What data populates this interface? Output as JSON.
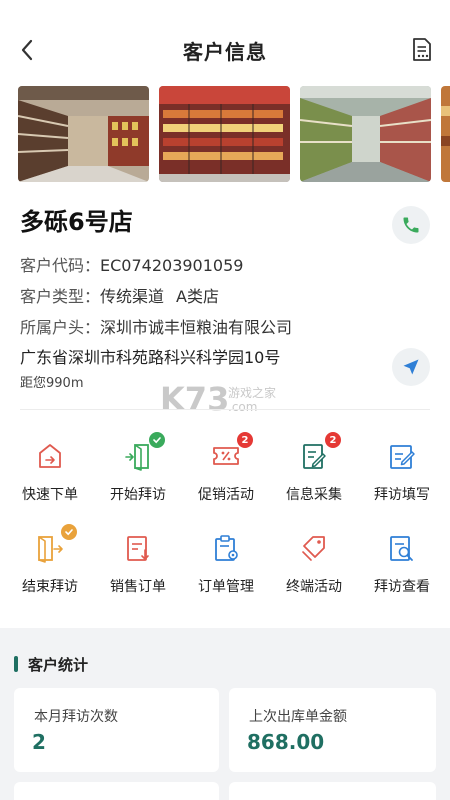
{
  "header": {
    "title": "客户信息",
    "back_icon": "chevron-left-icon",
    "action_icon": "document-list-icon"
  },
  "store": {
    "name": "多砾6号店",
    "code_label": "客户代码：",
    "code_value": "EC074203901059",
    "type_label": "客户类型：",
    "type_value": "传统渠道",
    "type_grade": "A类店",
    "owner_label": "所属户头：",
    "owner_value": "深圳市诚丰恒粮油有限公司",
    "address": "广东省深圳市科苑路科兴科学园10号",
    "distance": "距您990m"
  },
  "watermark": {
    "logo": "K73",
    "line1": "游戏之家",
    "line2": ".com"
  },
  "functions": [
    {
      "label": "快速下单",
      "icon": "quick-order-icon",
      "badge": ""
    },
    {
      "label": "开始拜访",
      "icon": "start-visit-icon",
      "badge": "check"
    },
    {
      "label": "促销活动",
      "icon": "promotion-icon",
      "badge": "2"
    },
    {
      "label": "信息采集",
      "icon": "info-collect-icon",
      "badge": "2"
    },
    {
      "label": "拜访填写",
      "icon": "visit-fill-icon",
      "badge": ""
    },
    {
      "label": "结束拜访",
      "icon": "end-visit-icon",
      "badge": "check"
    },
    {
      "label": "销售订单",
      "icon": "sales-order-icon",
      "badge": ""
    },
    {
      "label": "订单管理",
      "icon": "order-manage-icon",
      "badge": ""
    },
    {
      "label": "终端活动",
      "icon": "terminal-activity-icon",
      "badge": ""
    },
    {
      "label": "拜访查看",
      "icon": "visit-view-icon",
      "badge": ""
    }
  ],
  "stats": {
    "title": "客户统计",
    "cards": [
      {
        "label": "本月拜访次数",
        "value": "2"
      },
      {
        "label": "上次出库单金额",
        "value": "868.00"
      }
    ]
  },
  "colors": {
    "accent": "#1f6f62",
    "red_icon": "#e05a4f",
    "green_icon": "#3aaa5c",
    "blue_icon": "#2f7fd6",
    "orange_icon": "#e9a23b",
    "badge_red": "#e53935",
    "badge_green": "#3aaa5c",
    "badge_orange": "#e9a23b"
  }
}
